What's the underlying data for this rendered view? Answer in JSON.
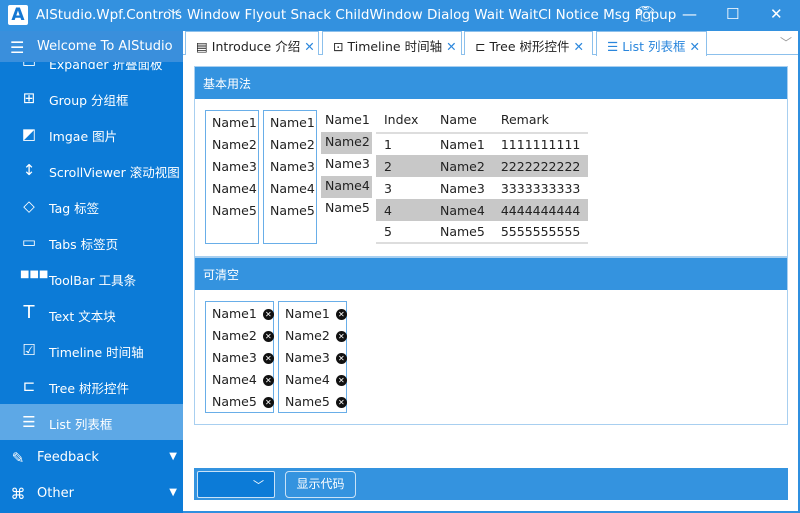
{
  "titlebar": {
    "logo": "A",
    "app_name": "AIStudio.Wpf.Controls",
    "menu": [
      "Window",
      "Flyout",
      "Snack",
      "ChildWindow",
      "Dialog",
      "Wait",
      "WaitCl",
      "Notice",
      "Msg",
      "Popup"
    ],
    "icons": [
      "shirt-icon",
      "minimize-icon",
      "maximize-icon",
      "close-icon"
    ]
  },
  "sidebar": {
    "header": "Welcome To AIStudio",
    "items": [
      {
        "label": "Expander 折叠面板",
        "icon": "expander-icon"
      },
      {
        "label": "Group 分组框",
        "icon": "group-icon"
      },
      {
        "label": "Imgae 图片",
        "icon": "image-icon"
      },
      {
        "label": "ScrollViewer 滚动视图",
        "icon": "scroll-icon"
      },
      {
        "label": "Tag 标签",
        "icon": "tag-icon"
      },
      {
        "label": "Tabs 标签页",
        "icon": "tabs-icon"
      },
      {
        "label": "ToolBar 工具条",
        "icon": "toolbar-icon"
      },
      {
        "label": "Text 文本块",
        "icon": "text-icon"
      },
      {
        "label": "Timeline 时间轴",
        "icon": "timeline-icon"
      },
      {
        "label": "Tree 树形控件",
        "icon": "tree-icon"
      },
      {
        "label": "List 列表框",
        "icon": "list-icon",
        "selected": true
      }
    ],
    "groups": [
      {
        "label": "Feedback",
        "icon": "feedback-icon"
      },
      {
        "label": "Other",
        "icon": "other-icon"
      }
    ]
  },
  "tabs": [
    {
      "label": "Introduce 介绍"
    },
    {
      "label": "Timeline 时间轴"
    },
    {
      "label": "Tree 树形控件"
    },
    {
      "label": "List 列表框",
      "active": true
    }
  ],
  "section1": {
    "title": "基本用法",
    "list_items": [
      "Name1",
      "Name2",
      "Name3",
      "Name4",
      "Name5"
    ],
    "grid": {
      "columns": [
        "Index",
        "Name",
        "Remark"
      ],
      "rows": [
        [
          "1",
          "Name1",
          "1111111111"
        ],
        [
          "2",
          "Name2",
          "2222222222"
        ],
        [
          "3",
          "Name3",
          "3333333333"
        ],
        [
          "4",
          "Name4",
          "4444444444"
        ],
        [
          "5",
          "Name5",
          "5555555555"
        ]
      ]
    }
  },
  "section2": {
    "title": "可清空",
    "list_items": [
      "Name1",
      "Name2",
      "Name3",
      "Name4",
      "Name5"
    ]
  },
  "bottom": {
    "select_value": "",
    "show_code": "显示代码"
  },
  "colors": {
    "accent": "#3493df",
    "sidebar": "#0c7bd7",
    "selected": "#5da8e6",
    "highlight": "#c8c8c8"
  }
}
